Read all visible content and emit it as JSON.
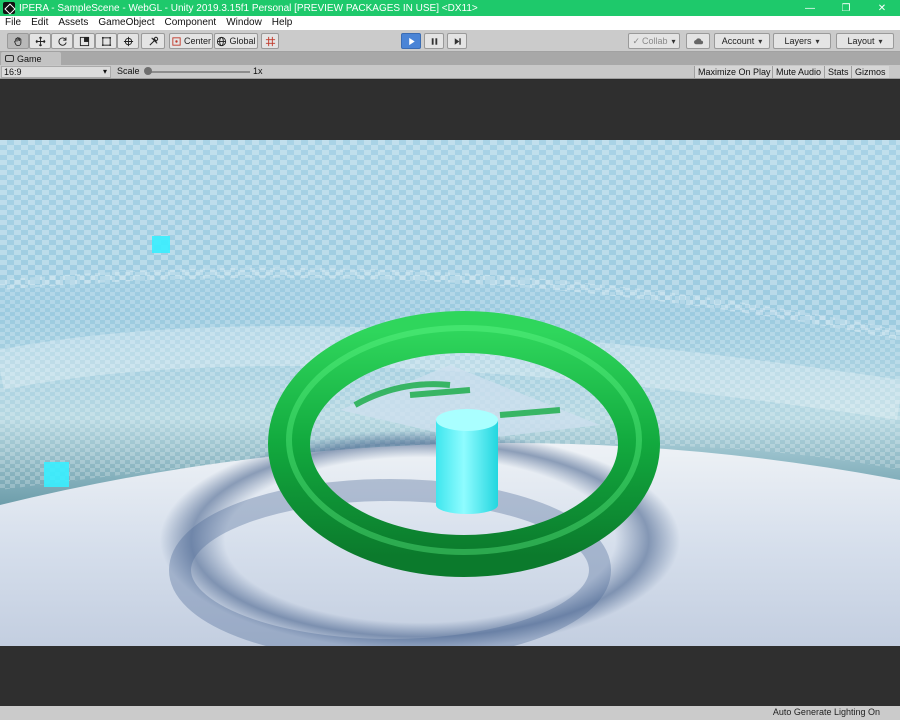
{
  "window": {
    "title": "IPERA - SampleScene - WebGL - Unity 2019.3.15f1 Personal [PREVIEW PACKAGES IN USE] <DX11>",
    "controls": [
      "—",
      "❐",
      "✕"
    ]
  },
  "menu": [
    "File",
    "Edit",
    "Assets",
    "GameObject",
    "Component",
    "Window",
    "Help"
  ],
  "toolbar": {
    "pivot_label": "Center",
    "space_label": "Global",
    "collab_label": "Collab",
    "account_label": "Account",
    "layers_label": "Layers",
    "layout_label": "Layout"
  },
  "game_view": {
    "tab_label": "Game",
    "aspect": "16:9",
    "scale_label": "Scale",
    "scale_value": "1x",
    "maximize_label": "Maximize On Play",
    "mute_label": "Mute Audio",
    "stats_label": "Stats",
    "gizmos_label": "Gizmos"
  },
  "status": {
    "text": "Auto Generate Lighting On"
  },
  "colors": {
    "title_bar": "#1ec96b",
    "torus": "#12a93e",
    "cylinder": "#35f2f2",
    "sky": "#7fb3c6"
  }
}
